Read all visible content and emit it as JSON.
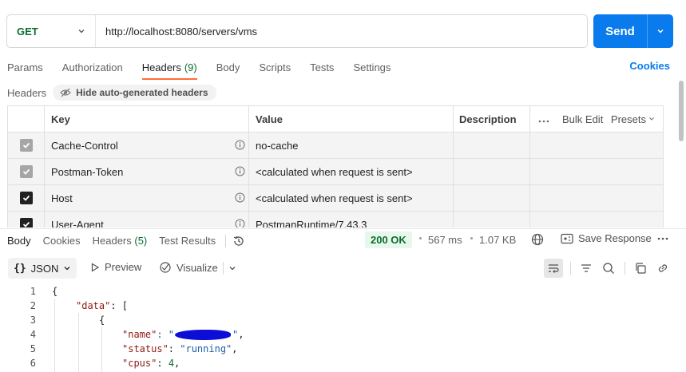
{
  "request": {
    "method": "GET",
    "url": "http://localhost:8080/servers/vms",
    "send_label": "Send"
  },
  "tabs": [
    {
      "label": "Params",
      "count": ""
    },
    {
      "label": "Authorization",
      "count": ""
    },
    {
      "label": "Headers",
      "count": "(9)"
    },
    {
      "label": "Body",
      "count": ""
    },
    {
      "label": "Scripts",
      "count": ""
    },
    {
      "label": "Tests",
      "count": ""
    },
    {
      "label": "Settings",
      "count": ""
    }
  ],
  "cookies_label": "Cookies",
  "headers_panel": {
    "title": "Headers",
    "hide_auto_label": "Hide auto-generated headers",
    "columns": {
      "key": "Key",
      "value": "Value",
      "description": "Description"
    },
    "bulk_edit_label": "Bulk Edit",
    "presets_label": "Presets",
    "rows": [
      {
        "key": "Cache-Control",
        "value": "no-cache",
        "checked": "auto"
      },
      {
        "key": "Postman-Token",
        "value": "<calculated when request is sent>",
        "checked": "auto"
      },
      {
        "key": "Host",
        "value": "<calculated when request is sent>",
        "checked": "true"
      },
      {
        "key": "User-Agent",
        "value": "PostmanRuntime/7.43.3",
        "checked": "true"
      }
    ]
  },
  "response": {
    "tabs": [
      {
        "label": "Body",
        "count": ""
      },
      {
        "label": "Cookies",
        "count": ""
      },
      {
        "label": "Headers",
        "count": "(5)"
      },
      {
        "label": "Test Results",
        "count": ""
      }
    ],
    "status": "200 OK",
    "time": "567 ms",
    "size": "1.07 KB",
    "save_label": "Save Response",
    "format_label": "JSON",
    "preview_label": "Preview",
    "visualize_label": "Visualize",
    "lines": [
      "1",
      "2",
      "3",
      "4",
      "5",
      "6"
    ],
    "code": {
      "l2_key": "\"data\"",
      "l2_rest": ": [",
      "l4_key": "\"name\"",
      "l4_q": ": \"",
      "l5_key": "\"status\"",
      "l5_val": "\"running\"",
      "l6_key": "\"cpus\"",
      "l6_val": "4"
    }
  },
  "colors": {
    "accent": "#097bed",
    "method_green": "#0b6e31",
    "active_tab_underline": "#ff6c37",
    "status_bg": "#e8f7ec"
  }
}
